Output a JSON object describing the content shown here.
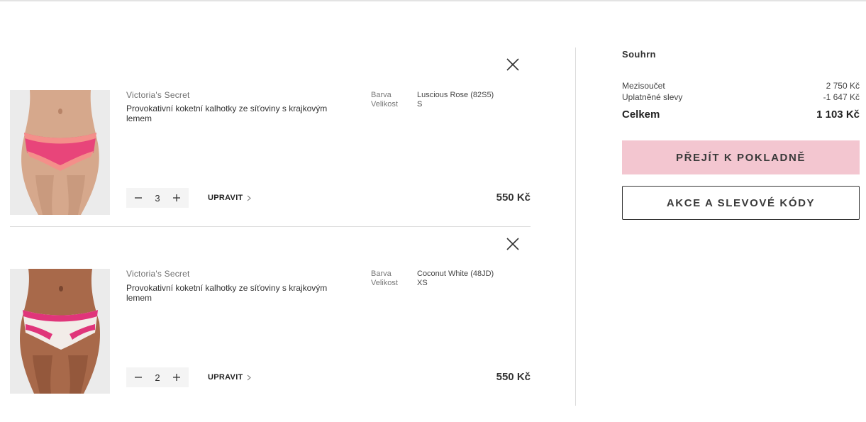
{
  "cart": {
    "items": [
      {
        "brand": "Victoria's Secret",
        "name": "Provokativní koketní kalhotky ze síťoviny s krajkovým lemem",
        "color_label": "Barva",
        "size_label": "Velikost",
        "color_value": "Luscious Rose (82S5)",
        "size_value": "S",
        "quantity": "3",
        "edit_label": "UPRAVIT",
        "price": "550 Kč"
      },
      {
        "brand": "Victoria's Secret",
        "name": "Provokativní koketní kalhotky ze síťoviny s krajkovým lemem",
        "color_label": "Barva",
        "size_label": "Velikost",
        "color_value": "Coconut White (48JD)",
        "size_value": "XS",
        "quantity": "2",
        "edit_label": "UPRAVIT",
        "price": "550 Kč"
      }
    ]
  },
  "summary": {
    "title": "Souhrn",
    "subtotal_label": "Mezisoučet",
    "subtotal_value": "2 750 Kč",
    "discount_label": "Uplatněné slevy",
    "discount_value": "-1 647 Kč",
    "total_label": "Celkem",
    "total_value": "1 103 Kč",
    "checkout_label": "PŘEJÍT K POKLADNĚ",
    "promo_label": "AKCE A SLEVOVÉ KÓDY"
  },
  "colors": {
    "checkout_bg": "#f3c6d0",
    "product1_pink": "#e8457a",
    "product2_pink": "#e0357a"
  },
  "icons": {
    "remove": "close-icon",
    "qty_minus": "minus-icon",
    "qty_plus": "plus-icon",
    "edit": "chevron-right-icon"
  }
}
